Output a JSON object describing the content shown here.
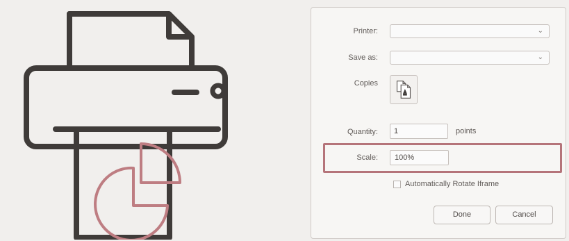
{
  "dialog": {
    "printer_label": "Printer:",
    "printer_value": "",
    "save_as_label": "Save as:",
    "save_as_value": "",
    "copies_label": "Copies",
    "quantity_label": "Quantity:",
    "quantity_value": "1",
    "quantity_unit": "points",
    "scale_label": "Scale:",
    "scale_value": "100%",
    "checkbox_label": "Automatically Rotate Iframe",
    "done_label": "Done",
    "cancel_label": "Cancel"
  },
  "icons": {
    "dropdown_arrow": "⌄",
    "illustration": "printer-icon"
  },
  "colors": {
    "highlight": "#b5747a",
    "illustration_stroke": "#3f3b39",
    "chart_stroke": "#be7d82"
  }
}
